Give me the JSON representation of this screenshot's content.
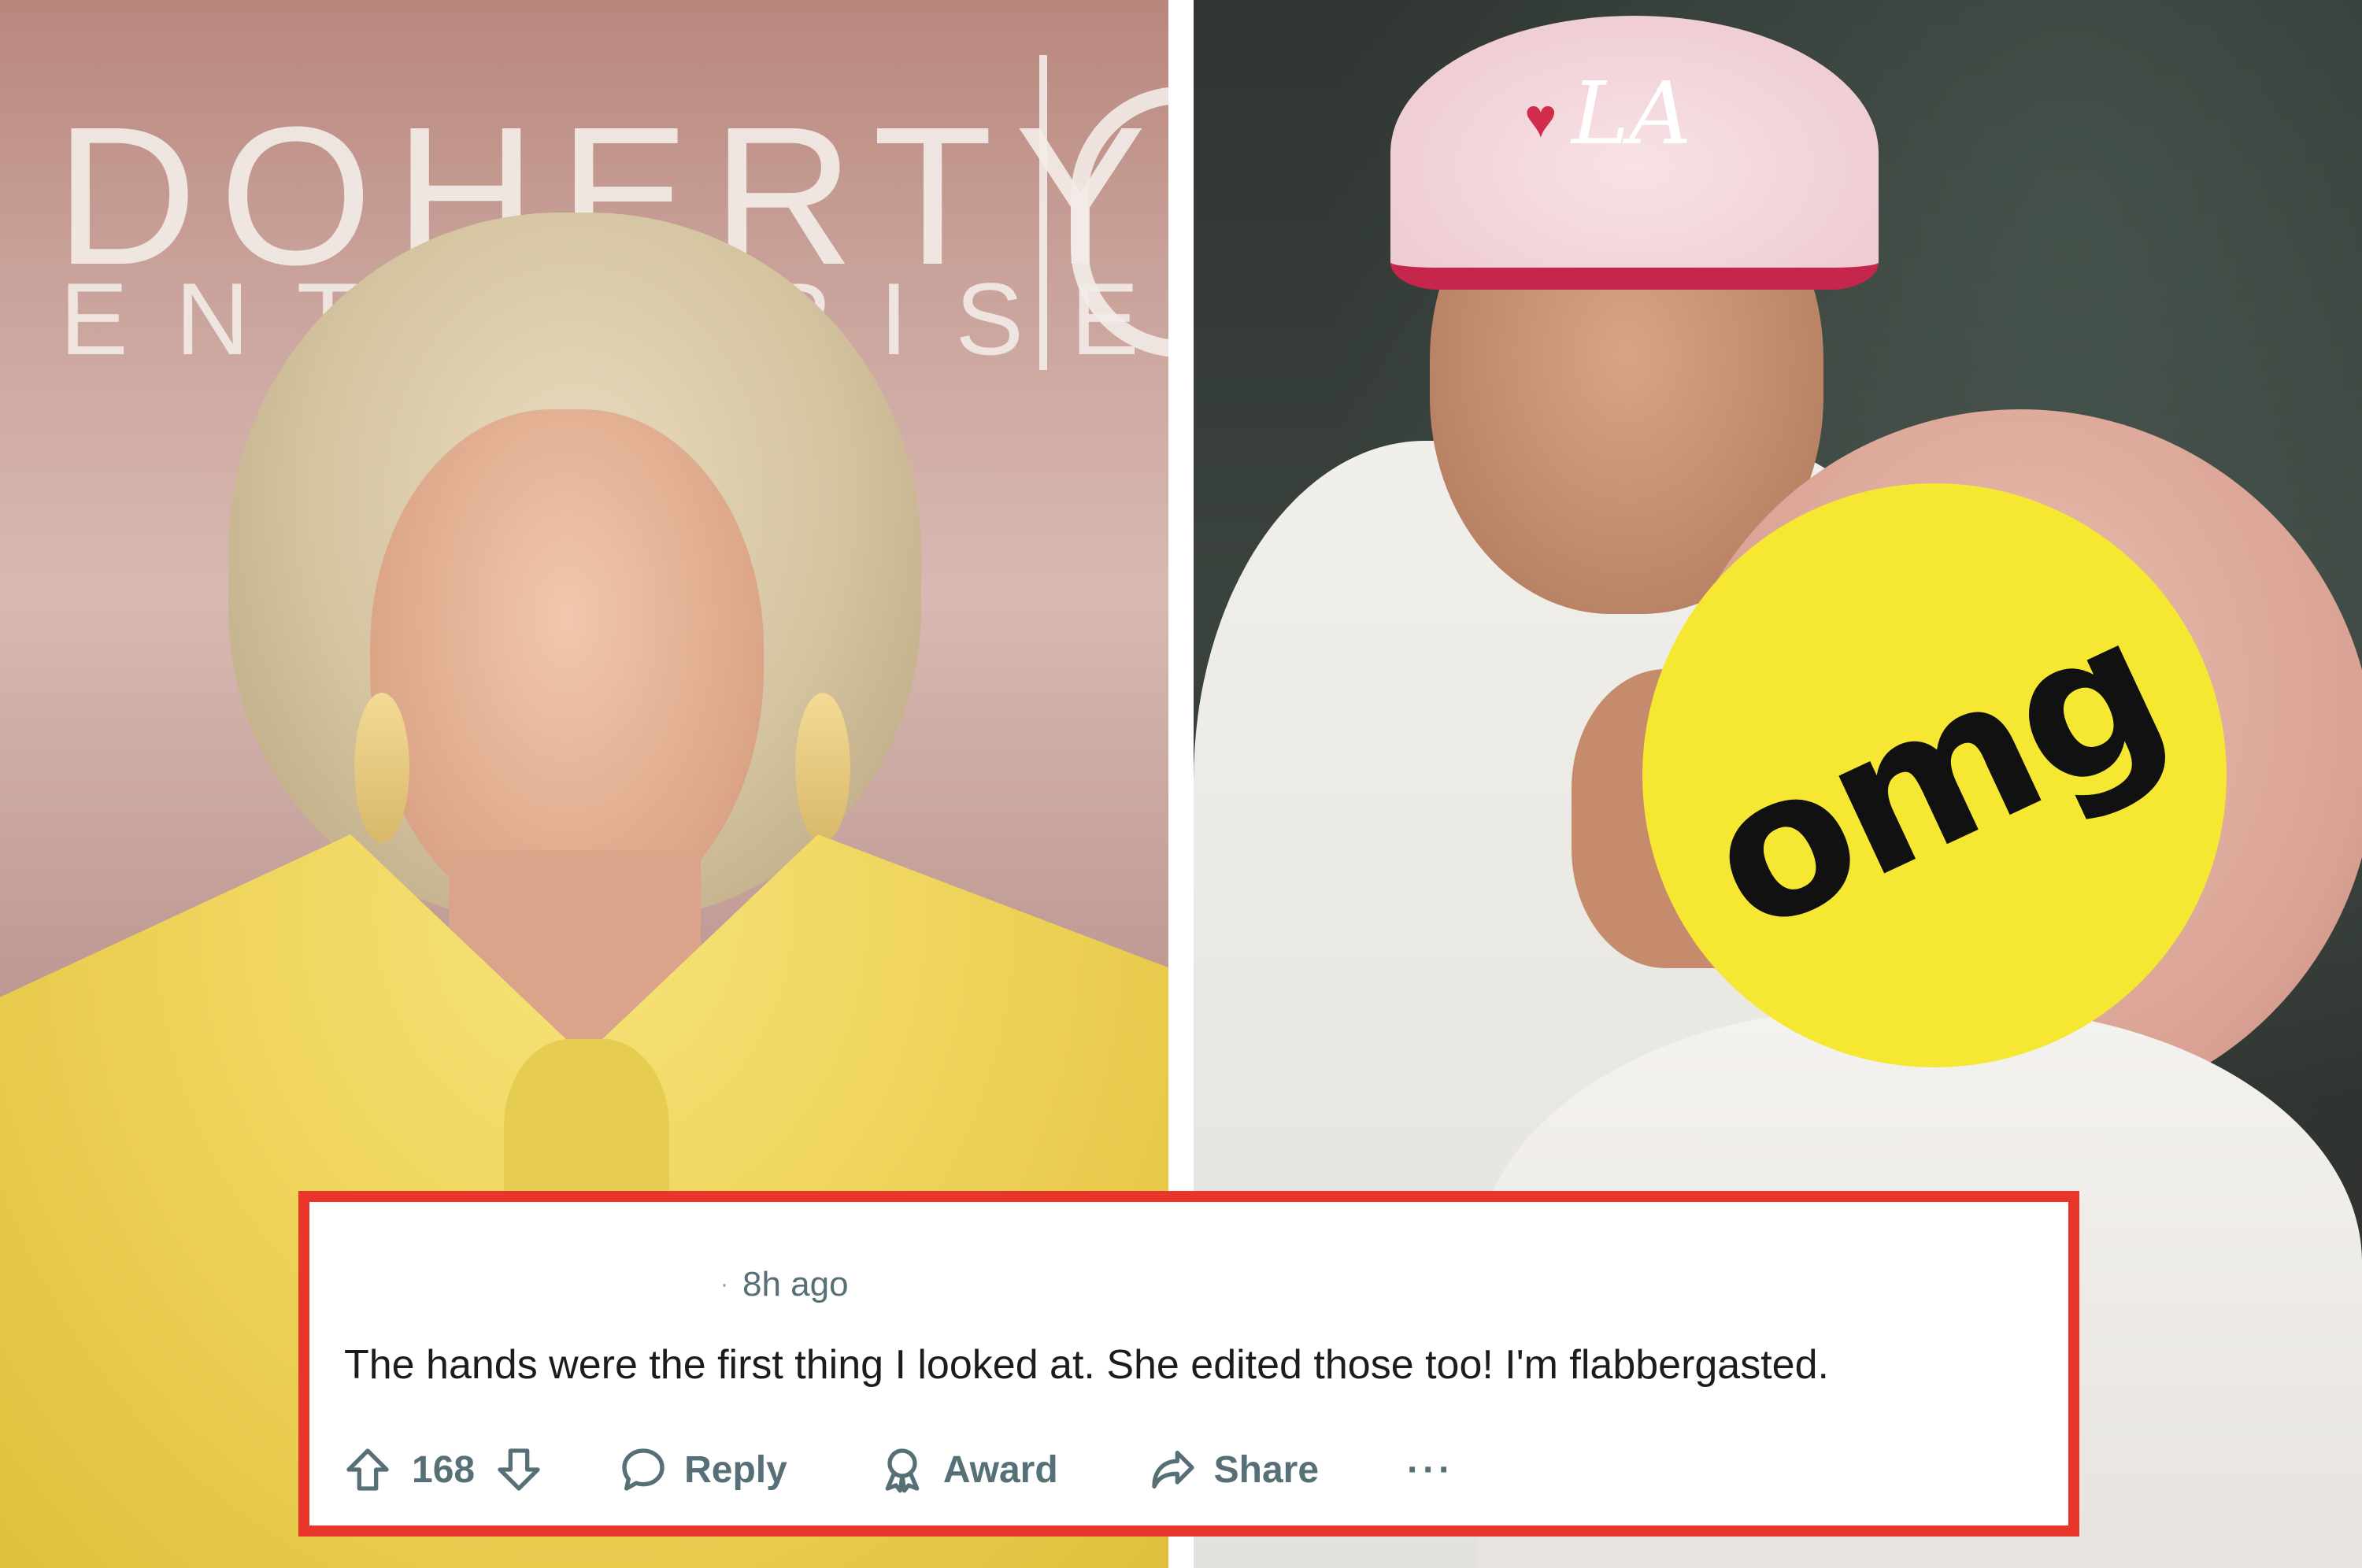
{
  "background": {
    "left_panel": {
      "sign_text": "DOHERTY",
      "sign_subtext": "ENTERPRISES"
    },
    "right_panel": {
      "cap_logo": "LA",
      "badge_text": "omg"
    }
  },
  "comment": {
    "timestamp": "8h ago",
    "separator": "·",
    "body": "The hands were the first thing I looked at. She edited those too! I'm flabbergasted.",
    "vote_count": "168",
    "reply_label": "Reply",
    "award_label": "Award",
    "share_label": "Share",
    "more_label": "···"
  },
  "colors": {
    "highlight_border": "#e8362b",
    "badge_yellow": "#f6e733",
    "meta_text": "#576f76"
  },
  "icons": [
    "upvote-icon",
    "downvote-icon",
    "reply-bubble-icon",
    "award-icon",
    "share-arrow-icon",
    "more-icon"
  ]
}
